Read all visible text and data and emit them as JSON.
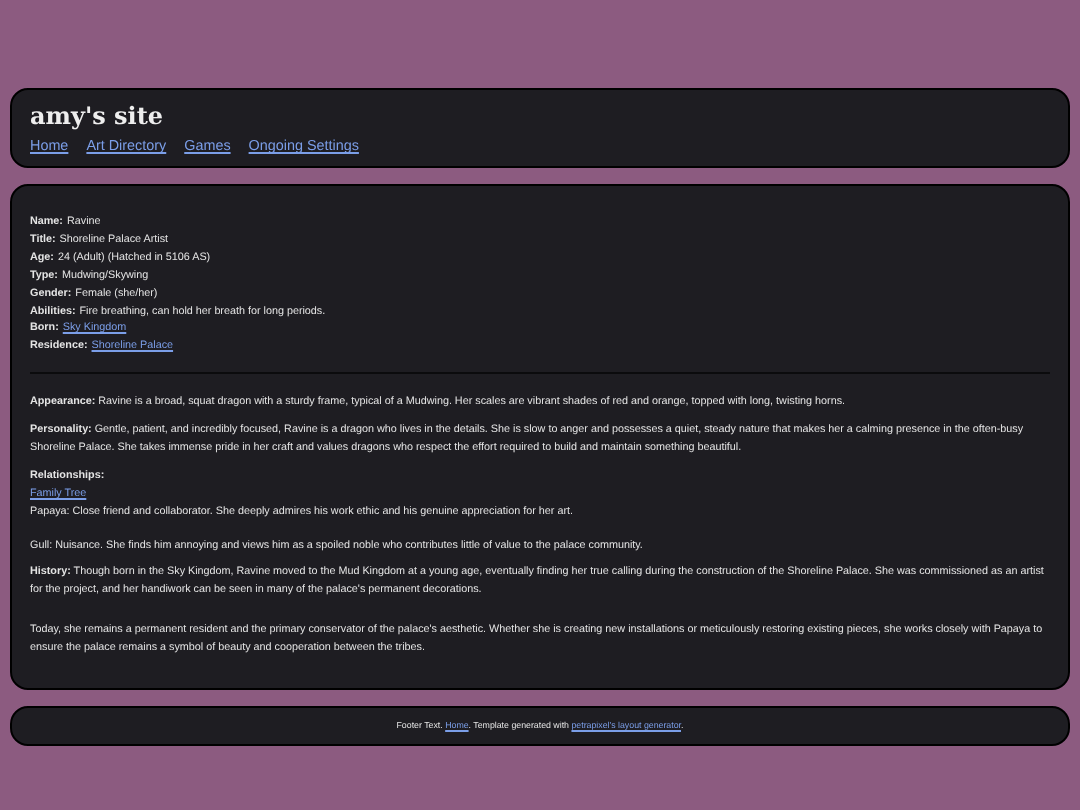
{
  "header": {
    "title": "amy's site",
    "nav": [
      {
        "label": "Home"
      },
      {
        "label": "Art Directory"
      },
      {
        "label": "Games"
      },
      {
        "label": "Ongoing Settings"
      }
    ]
  },
  "profile": [
    {
      "label": "Name:",
      "value": "Ravine",
      "link": false
    },
    {
      "label": "Title:",
      "value": "Shoreline Palace Artist",
      "link": false
    },
    {
      "label": "Age:",
      "value": "24 (Adult) (Hatched in 5106 AS)",
      "link": false
    },
    {
      "label": "Type:",
      "value": "Mudwing/Skywing",
      "link": false
    },
    {
      "label": "Gender:",
      "value": "Female (she/her)",
      "link": false
    },
    {
      "label": "Abilities:",
      "value": "Fire breathing, can hold her breath for long periods.",
      "link": false
    },
    {
      "label": "Born:",
      "value": "Sky Kingdom",
      "link": true
    },
    {
      "label": "Residence:",
      "value": "Shoreline Palace",
      "link": true
    }
  ],
  "appearance": {
    "label": "Appearance:",
    "text": "Ravine is a broad, squat dragon with a sturdy frame, typical of a Mudwing. Her scales are vibrant shades of red and orange, topped with long, twisting horns."
  },
  "personality": {
    "label": "Personality:",
    "text": "Gentle, patient, and incredibly focused, Ravine is a dragon who lives in the details. She is slow to anger and possesses a quiet, steady nature that makes her a calming presence in the often-busy Shoreline Palace. She takes immense pride in her craft and values dragons who respect the effort required to build and maintain something beautiful."
  },
  "relationships": {
    "label": "Relationships:",
    "link": "Family Tree",
    "lines": [
      "Papaya: Close friend and collaborator. She deeply admires his work ethic and his genuine appreciation for her art.",
      "Gull: Nuisance. She finds him annoying and views him as a spoiled noble who contributes little of value to the palace community."
    ]
  },
  "history": {
    "label": "History:",
    "paragraphs": [
      "Though born in the Sky Kingdom, Ravine moved to the Mud Kingdom at a young age, eventually finding her true calling during the construction of the Shoreline Palace. She was commissioned as an artist for the project, and her handiwork can be seen in many of the palace's permanent decorations.",
      "Today, she remains a permanent resident and the primary conservator of the palace's aesthetic. Whether she is creating new installations or meticulously restoring existing pieces, she works closely with Papaya to ensure the palace remains a symbol of beauty and cooperation between the tribes."
    ]
  },
  "footer": {
    "text": "Footer Text.",
    "home_link": "Home",
    "middle": ". Template generated with",
    "generator_link": "petrapixel's layout generator",
    "end": "."
  }
}
